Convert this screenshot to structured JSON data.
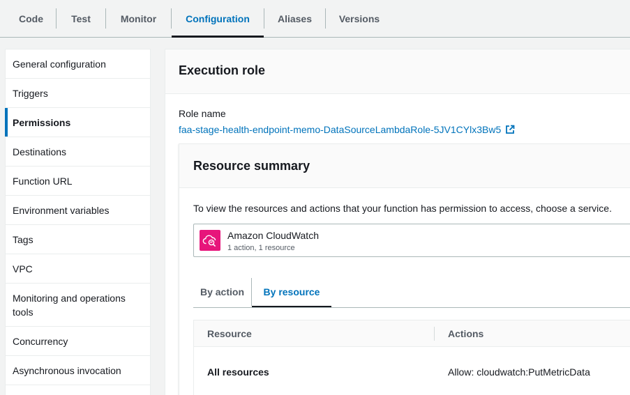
{
  "tabs": [
    {
      "label": "Code",
      "active": false
    },
    {
      "label": "Test",
      "active": false
    },
    {
      "label": "Monitor",
      "active": false
    },
    {
      "label": "Configuration",
      "active": true
    },
    {
      "label": "Aliases",
      "active": false
    },
    {
      "label": "Versions",
      "active": false
    }
  ],
  "sidebar": {
    "items": [
      {
        "label": "General configuration"
      },
      {
        "label": "Triggers"
      },
      {
        "label": "Permissions",
        "active": true
      },
      {
        "label": "Destinations"
      },
      {
        "label": "Function URL"
      },
      {
        "label": "Environment variables"
      },
      {
        "label": "Tags"
      },
      {
        "label": "VPC"
      },
      {
        "label": "Monitoring and operations tools"
      },
      {
        "label": "Concurrency"
      },
      {
        "label": "Asynchronous invocation"
      }
    ]
  },
  "execution_role": {
    "title": "Execution role",
    "role_name_label": "Role name",
    "role_name": "faa-stage-health-endpoint-memo-DataSourceLambdaRole-5JV1CYlx3Bw5",
    "link_icon": "external-link-icon"
  },
  "resource_summary": {
    "title": "Resource summary",
    "instruction": "To view the resources and actions that your function has permission to access, choose a service.",
    "service": {
      "name": "Amazon CloudWatch",
      "meta": "1 action, 1 resource",
      "icon": "cloudwatch-icon",
      "icon_color": "#e7157b"
    },
    "view_tabs": [
      {
        "label": "By action",
        "active": false
      },
      {
        "label": "By resource",
        "active": true
      }
    ],
    "table": {
      "columns": [
        "Resource",
        "Actions"
      ],
      "rows": [
        {
          "resource": "All resources",
          "actions": "Allow: cloudwatch:PutMetricData"
        }
      ]
    }
  },
  "colors": {
    "accent": "#0073bb",
    "text": "#16191f",
    "muted": "#545b64",
    "background": "#f2f3f3"
  }
}
